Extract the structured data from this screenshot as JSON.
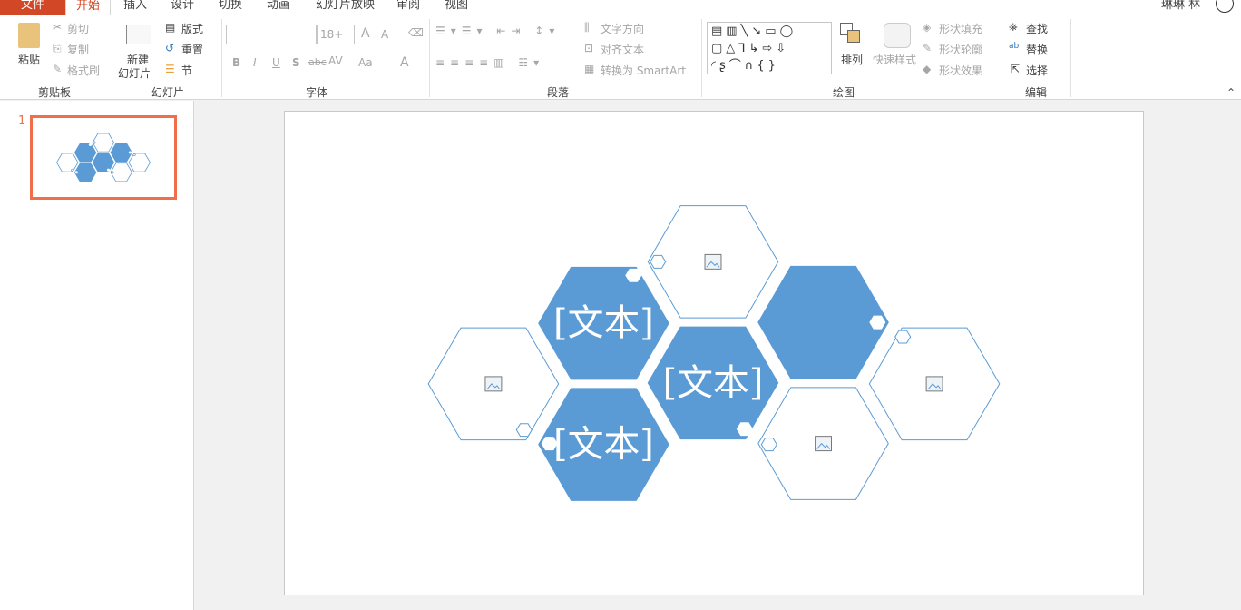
{
  "tabs": [
    "文件",
    "开始",
    "插入",
    "设计",
    "切换",
    "动画",
    "幻灯片放映",
    "审阅",
    "视图"
  ],
  "user": {
    "name": "琳琳 林"
  },
  "clipboard": {
    "paste": "粘贴",
    "cut": "剪切",
    "copy": "复制",
    "format_painter": "格式刷",
    "label": "剪贴板"
  },
  "slides": {
    "new_slide_1": "新建",
    "new_slide_2": "幻灯片",
    "layout": "版式",
    "reset": "重置",
    "section": "节",
    "label": "幻灯片"
  },
  "font": {
    "name_value": "",
    "size_value": "18+",
    "bold": "B",
    "italic": "I",
    "underline": "U",
    "shadow": "S",
    "strike": "abc",
    "spacing": "AV",
    "case": "Aa",
    "color": "A",
    "grow": "A",
    "shrink": "A",
    "label": "字体"
  },
  "paragraph": {
    "text_direction": "文字方向",
    "align_text": "对齐文本",
    "smartart": "转换为 SmartArt",
    "label": "段落"
  },
  "drawing": {
    "arrange": "排列",
    "quick_styles": "快速样式",
    "fill": "形状填充",
    "outline": "形状轮廓",
    "effects": "形状效果",
    "label": "绘图"
  },
  "editing": {
    "find": "查找",
    "replace": "替换",
    "select": "选择",
    "label": "编辑"
  },
  "thumbnail": {
    "number": "1"
  },
  "slide_content": {
    "text_placeholder": "[文本]",
    "accent": "#5b9bd5",
    "outline": "#5b9bd5"
  }
}
